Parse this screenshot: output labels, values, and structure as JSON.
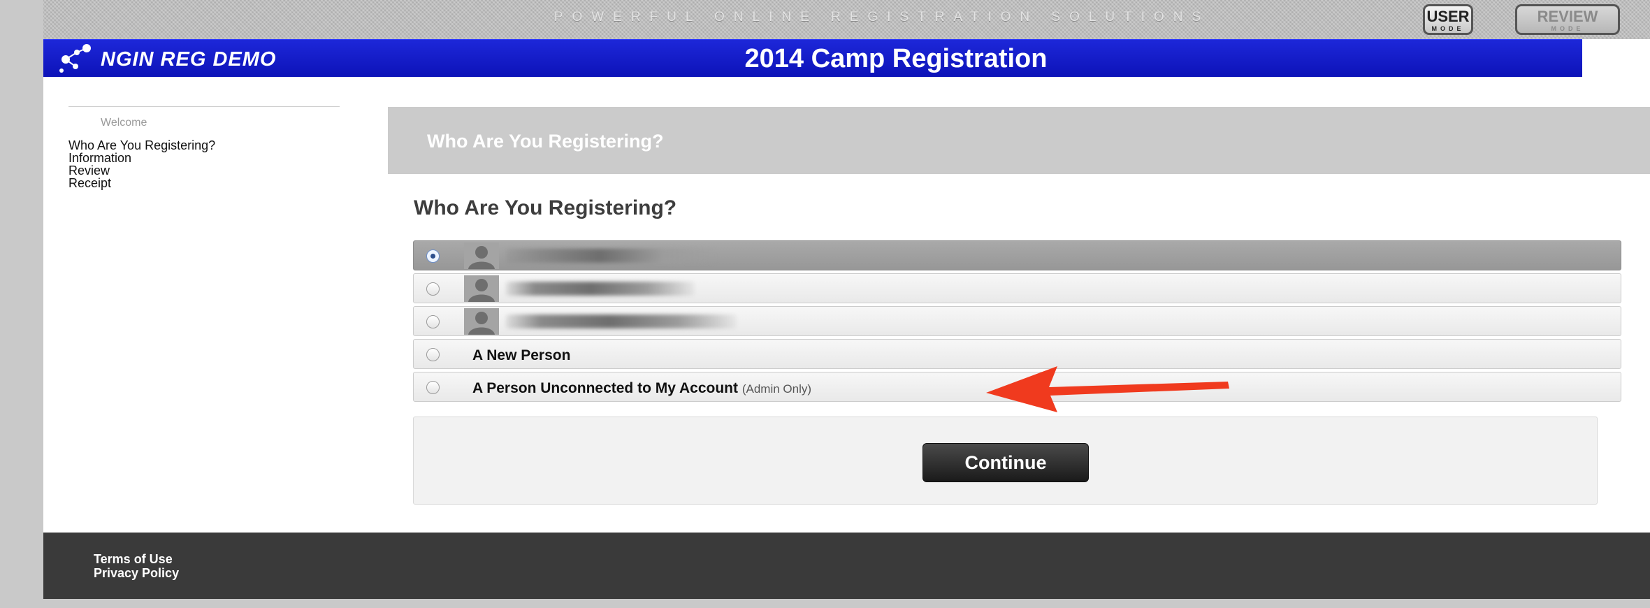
{
  "top_band": {
    "tagline": "POWERFUL ONLINE REGISTRATION SOLUTIONS",
    "user_mode": {
      "label": "USER",
      "sub": "MODE"
    },
    "review_mode": {
      "label": "REVIEW",
      "sub": "MODE"
    }
  },
  "header": {
    "logo_text": "NGIN REG DEMO",
    "title": "2014 Camp Registration",
    "color": "#1520cf"
  },
  "sidebar": {
    "welcome": "Welcome",
    "nav": [
      "Who Are You Registering?",
      "Information",
      "Review",
      "Receipt"
    ]
  },
  "section_banner": {
    "title": "Who Are You Registering?"
  },
  "main": {
    "heading": "Who Are You Registering?",
    "options": [
      {
        "type": "person",
        "name_visible": false,
        "selected": true
      },
      {
        "type": "person",
        "name_visible": false,
        "selected": false
      },
      {
        "type": "person",
        "name_visible": false,
        "selected": false
      },
      {
        "type": "text",
        "label": "A New Person",
        "selected": false
      },
      {
        "type": "text",
        "label": "A Person Unconnected to My Account",
        "note": "(Admin Only)",
        "selected": false
      }
    ],
    "continue_label": "Continue"
  },
  "annotation": {
    "arrow_color": "#f03a1e",
    "points_to": "A Person Unconnected to My Account"
  },
  "footer": {
    "links": [
      "Terms of Use",
      "Privacy Policy"
    ]
  }
}
